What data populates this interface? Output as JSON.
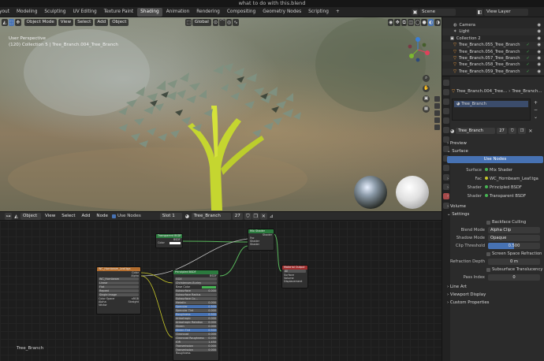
{
  "window": {
    "title": "what to do with this.blend"
  },
  "topbar": {
    "tabs": [
      "Layout",
      "Modeling",
      "Sculpting",
      "UV Editing",
      "Texture Paint",
      "Shading",
      "Animation",
      "Rendering",
      "Compositing",
      "Geometry Nodes",
      "Scripting"
    ],
    "active_tab": "Shading",
    "scene": "Scene",
    "view_layer": "View Layer"
  },
  "viewport": {
    "mode": "Object Mode",
    "menus": [
      "View",
      "Select",
      "Add",
      "Object"
    ],
    "orientation": "Global",
    "overlay_line1": "User Perspective",
    "overlay_line2": "(120) Collection 5 | Tree_Branch.004_Tree_Branch"
  },
  "outliner": {
    "rows": [
      {
        "name": "Camera",
        "type": "camera"
      },
      {
        "name": "Light",
        "type": "light"
      },
      {
        "name": "Collection 2",
        "type": "collection"
      },
      {
        "name": "Tree_Branch.055_Tree_Branch",
        "type": "mesh"
      },
      {
        "name": "Tree_Branch.056_Tree_Branch",
        "type": "mesh"
      },
      {
        "name": "Tree_Branch.057_Tree_Branch",
        "type": "mesh"
      },
      {
        "name": "Tree_Branch.058_Tree_Branch",
        "type": "mesh"
      },
      {
        "name": "Tree_Branch.059_Tree_Branch",
        "type": "mesh"
      }
    ]
  },
  "properties": {
    "object_name": "Tree_Branch.004_Tree...",
    "material_name_short": "Tree_Branch...",
    "slot_item": "Tree_Branch",
    "material": "Tree_Branch",
    "user_count": "27",
    "sections": {
      "preview": "Preview",
      "surface": "Surface",
      "volume": "Volume",
      "settings": "Settings",
      "line_art": "Line Art",
      "viewport_display": "Viewport Display",
      "custom_properties": "Custom Properties"
    },
    "use_nodes": "Use Nodes",
    "surface_label": "Surface",
    "surface_value": "Mix Shader",
    "fac_label": "Fac",
    "fac_value": "WC_Hornbeam_Leaf.tga",
    "shader1_label": "Shader",
    "shader1_value": "Principled BSDF",
    "shader2_label": "Shader",
    "shader2_value": "Transparent BSDF",
    "backface_culling": "Backface Culling",
    "blend_mode_label": "Blend Mode",
    "blend_mode_value": "Alpha Clip",
    "shadow_mode_label": "Shadow Mode",
    "shadow_mode_value": "Opaque",
    "clip_threshold_label": "Clip Threshold",
    "clip_threshold_value": "0.500",
    "screen_space_refraction": "Screen Space Refraction",
    "refraction_depth_label": "Refraction Depth",
    "refraction_depth_value": "0 m",
    "subsurface_translucency": "Subsurface Translucency",
    "pass_index_label": "Pass Index",
    "pass_index_value": "0"
  },
  "node_editor": {
    "editor_type": "Object",
    "menus": [
      "View",
      "Select",
      "Add",
      "Node"
    ],
    "use_nodes": "Use Nodes",
    "slot": "Slot 1",
    "material": "Tree_Branch",
    "users": "27",
    "footer_label": "Tree_Branch",
    "nodes": {
      "transparent": {
        "title": "Transparent BSDF",
        "out": "BSDF",
        "in": "Color"
      },
      "mix": {
        "title": "Mix Shader",
        "out": "Shader",
        "inputs": [
          "Fac",
          "Shader",
          "Shader"
        ]
      },
      "material_output": {
        "title": "Material Output",
        "target": "All",
        "inputs": [
          "Surface",
          "Volume",
          "Displacement"
        ]
      },
      "image_texture": {
        "title": "WC_Hornbeam_Leaf.tga",
        "outputs": [
          "Color",
          "Alpha"
        ],
        "image": "WC_Hornbeam",
        "options": [
          "Linear",
          "Flat",
          "Repeat",
          "Single Image"
        ],
        "color_space_label": "Color Space",
        "color_space_value": "sRGB",
        "alpha_label": "Alpha",
        "alpha_value": "Straight",
        "vector": "Vector"
      },
      "principled": {
        "title": "Principled BSDF",
        "out": "BSDF",
        "options": [
          "GGX",
          "Christensen-Burley"
        ],
        "rows": [
          {
            "label": "Base Color",
            "value": "",
            "kind": "color"
          },
          {
            "label": "Subsurface",
            "value": "0.000",
            "kind": "plain"
          },
          {
            "label": "Subsurface Radius",
            "value": "",
            "kind": "plain"
          },
          {
            "label": "Subsurface Co...",
            "value": "",
            "kind": "plain"
          },
          {
            "label": "Metallic",
            "value": "0.000",
            "kind": "plain"
          },
          {
            "label": "Specular",
            "value": "0.500",
            "kind": "blue"
          },
          {
            "label": "Specular Tint",
            "value": "0.000",
            "kind": "plain"
          },
          {
            "label": "Roughness",
            "value": "0.500",
            "kind": "blue"
          },
          {
            "label": "Anisotropic",
            "value": "0.000",
            "kind": "plain"
          },
          {
            "label": "Anisotropic Rotation",
            "value": "0.000",
            "kind": "plain"
          },
          {
            "label": "Sheen",
            "value": "0.000",
            "kind": "plain"
          },
          {
            "label": "Sheen Tint",
            "value": "0.500",
            "kind": "blue"
          },
          {
            "label": "Clearcoat",
            "value": "0.000",
            "kind": "plain"
          },
          {
            "label": "Clearcoat Roughness",
            "value": "0.030",
            "kind": "plain"
          },
          {
            "label": "IOR",
            "value": "1.450",
            "kind": "plain"
          },
          {
            "label": "Transmission",
            "value": "0.000",
            "kind": "plain"
          },
          {
            "label": "Transmission Roughness",
            "value": "0.000",
            "kind": "plain"
          }
        ]
      }
    }
  },
  "colors": {
    "accent_blue": "#4772b3",
    "shader_green": "#46b453",
    "node_header_principled": "#2b7a3e",
    "node_header_image": "#b36e2f",
    "node_header_output": "#a02f2f",
    "socket_yellow": "#c7c729"
  }
}
